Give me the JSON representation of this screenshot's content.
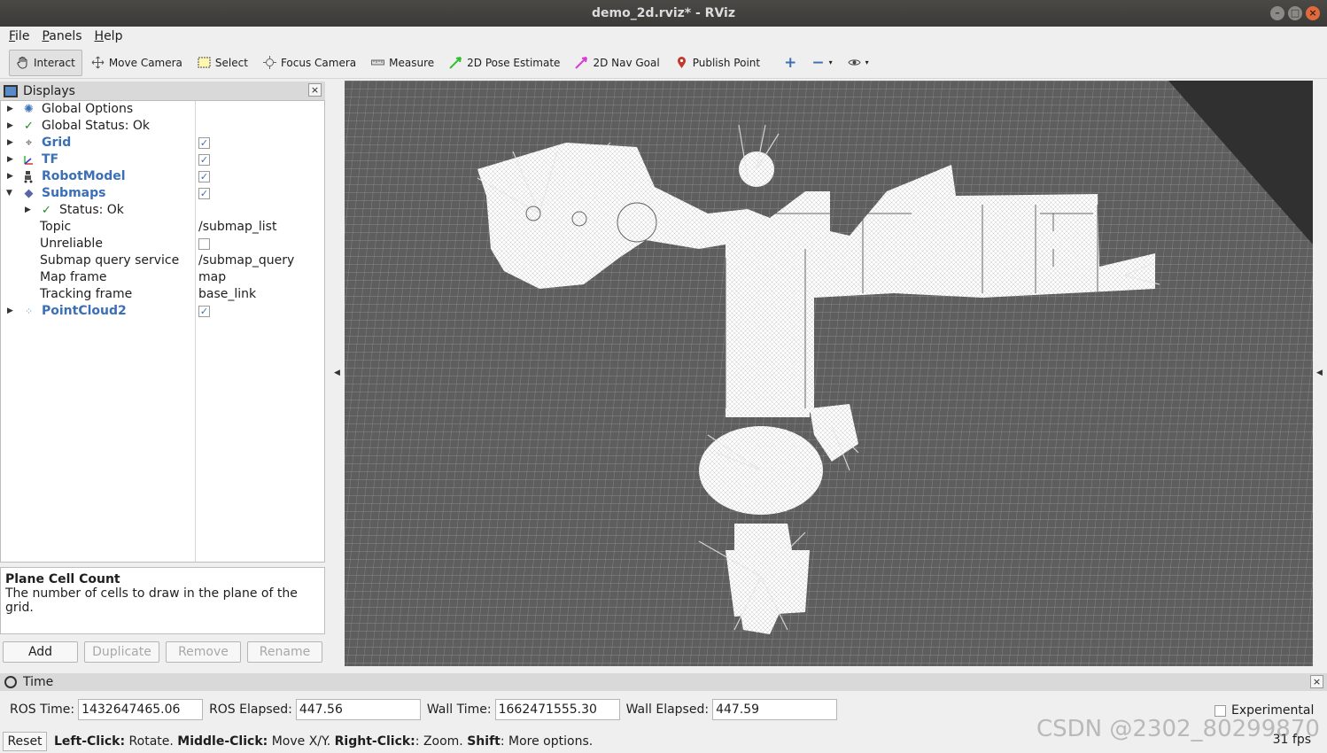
{
  "window": {
    "title": "demo_2d.rviz* - RViz",
    "controls": [
      "–",
      "□",
      "×"
    ]
  },
  "menu": [
    "File",
    "Panels",
    "Help"
  ],
  "toolbar": {
    "tools": [
      {
        "label": "Interact",
        "icon": "hand-icon",
        "color": "#333333",
        "active": true
      },
      {
        "label": "Move Camera",
        "icon": "move-camera-icon",
        "color": "#555555"
      },
      {
        "label": "Select",
        "icon": "select-icon",
        "color": "#c8a400"
      },
      {
        "label": "Focus Camera",
        "icon": "focus-camera-icon",
        "color": "#666666"
      },
      {
        "label": "Measure",
        "icon": "ruler-icon",
        "color": "#666666"
      },
      {
        "label": "2D Pose Estimate",
        "icon": "pose-arrow-icon",
        "color": "#2fbf2f"
      },
      {
        "label": "2D Nav Goal",
        "icon": "nav-goal-arrow-icon",
        "color": "#d63bd6"
      },
      {
        "label": "Publish Point",
        "icon": "map-pin-icon",
        "color": "#c0392b"
      }
    ],
    "plus": "+",
    "minus": "−"
  },
  "displays": {
    "title": "Displays",
    "close": "×",
    "items": [
      {
        "label": "Global Options",
        "icon": "gear-icon",
        "level": 0,
        "expanded": false,
        "blue": false
      },
      {
        "label": "Global Status: Ok",
        "icon": "check-icon",
        "level": 0,
        "expanded": false,
        "blue": false
      },
      {
        "label": "Grid",
        "icon": "grid-icon",
        "level": 0,
        "expanded": false,
        "blue": true,
        "checked": true
      },
      {
        "label": "TF",
        "icon": "tf-axes-icon",
        "level": 0,
        "expanded": false,
        "blue": true,
        "checked": true
      },
      {
        "label": "RobotModel",
        "icon": "robot-icon",
        "level": 0,
        "expanded": false,
        "blue": true,
        "checked": true
      },
      {
        "label": "Submaps",
        "icon": "submaps-icon",
        "level": 0,
        "expanded": true,
        "blue": true,
        "checked": true
      },
      {
        "label": "Status: Ok",
        "icon": "check-icon",
        "level": 1,
        "expanded": false,
        "blue": false
      },
      {
        "label": "Topic",
        "value": "/submap_list",
        "level": 1,
        "prop": true
      },
      {
        "label": "Unreliable",
        "level": 1,
        "prop": true,
        "checked": false
      },
      {
        "label": "Submap query service",
        "value": "/submap_query",
        "level": 1,
        "prop": true
      },
      {
        "label": "Map frame",
        "value": "map",
        "level": 1,
        "prop": true
      },
      {
        "label": "Tracking frame",
        "value": "base_link",
        "level": 1,
        "prop": true
      },
      {
        "label": "PointCloud2",
        "icon": "pointcloud-icon",
        "level": 0,
        "expanded": false,
        "blue": true,
        "checked": true
      }
    ],
    "description": {
      "title": "Plane Cell Count",
      "text": "The number of cells to draw in the plane of the grid."
    },
    "buttons": [
      {
        "label": "Add",
        "enabled": true
      },
      {
        "label": "Duplicate",
        "enabled": false
      },
      {
        "label": "Remove",
        "enabled": false
      },
      {
        "label": "Rename",
        "enabled": false
      }
    ]
  },
  "time": {
    "title": "Time",
    "close": "×",
    "ros_time_label": "ROS Time:",
    "ros_time": "1432647465.06",
    "ros_elapsed_label": "ROS Elapsed:",
    "ros_elapsed": "447.56",
    "wall_time_label": "Wall Time:",
    "wall_time": "1662471555.30",
    "wall_elapsed_label": "Wall Elapsed:",
    "wall_elapsed": "447.59",
    "experimental_label": "Experimental"
  },
  "status": {
    "reset": "Reset",
    "hint_parts": [
      {
        "text": "Left-Click:",
        "bold": true
      },
      {
        "text": " Rotate. ",
        "bold": false
      },
      {
        "text": "Middle-Click:",
        "bold": true
      },
      {
        "text": " Move X/Y. ",
        "bold": false
      },
      {
        "text": "Right-Click:",
        "bold": true
      },
      {
        "text": ": Zoom. ",
        "bold": false
      },
      {
        "text": "Shift",
        "bold": true
      },
      {
        "text": ": More options.",
        "bold": false
      }
    ],
    "fps": "31 fps"
  },
  "watermark": "CSDN @2302_80299870",
  "colors": {
    "viewport_bg": "#303030",
    "grid_line": "#9a9a9a",
    "map_free": "#ffffff",
    "link_blue": "#3b6fb6"
  }
}
